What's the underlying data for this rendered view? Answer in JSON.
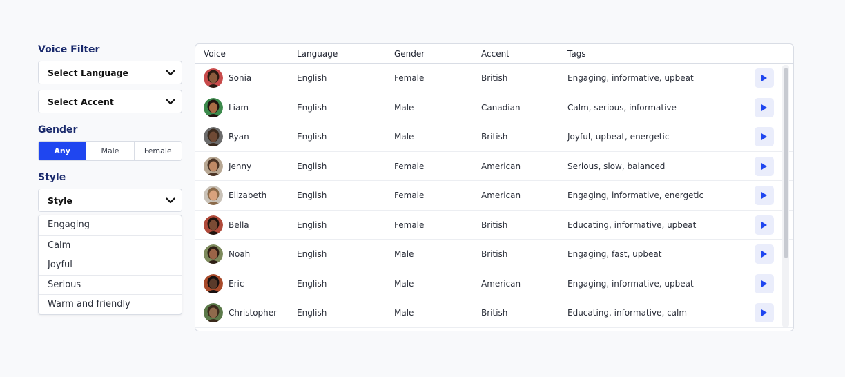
{
  "filters": {
    "voice_filter_title": "Voice Filter",
    "language_select": "Select Language",
    "accent_select": "Select Accent",
    "gender_title": "Gender",
    "gender_options": [
      "Any",
      "Male",
      "Female"
    ],
    "gender_selected": "Any",
    "style_title": "Style",
    "style_select": "Style",
    "style_options": [
      "Engaging",
      "Calm",
      "Joyful",
      "Serious",
      "Warm and friendly"
    ]
  },
  "table": {
    "headers": {
      "voice": "Voice",
      "language": "Language",
      "gender": "Gender",
      "accent": "Accent",
      "tags": "Tags"
    },
    "rows": [
      {
        "voice": "Sonia",
        "language": "English",
        "gender": "Female",
        "accent": "British",
        "tags": "Engaging, informative, upbeat"
      },
      {
        "voice": "Liam",
        "language": "English",
        "gender": "Male",
        "accent": "Canadian",
        "tags": "Calm, serious, informative"
      },
      {
        "voice": "Ryan",
        "language": "English",
        "gender": "Male",
        "accent": "British",
        "tags": "Joyful, upbeat, energetic"
      },
      {
        "voice": "Jenny",
        "language": "English",
        "gender": "Female",
        "accent": "American",
        "tags": "Serious, slow, balanced"
      },
      {
        "voice": "Elizabeth",
        "language": "English",
        "gender": "Female",
        "accent": "American",
        "tags": "Engaging, informative, energetic"
      },
      {
        "voice": "Bella",
        "language": "English",
        "gender": "Female",
        "accent": "British",
        "tags": "Educating, informative, upbeat"
      },
      {
        "voice": "Noah",
        "language": "English",
        "gender": "Male",
        "accent": "British",
        "tags": "Engaging, fast, upbeat"
      },
      {
        "voice": "Eric",
        "language": "English",
        "gender": "Male",
        "accent": "American",
        "tags": "Engaging, informative, upbeat"
      },
      {
        "voice": "Christopher",
        "language": "English",
        "gender": "Male",
        "accent": "British",
        "tags": "Educating, informative, calm"
      }
    ]
  },
  "colors": {
    "accent": "#1f46f0",
    "title": "#1a2a6c",
    "play_bg": "#eaedfb"
  },
  "icons": {
    "dropdown": "chevron-down-icon",
    "play": "play-icon",
    "avatar": "avatar"
  }
}
